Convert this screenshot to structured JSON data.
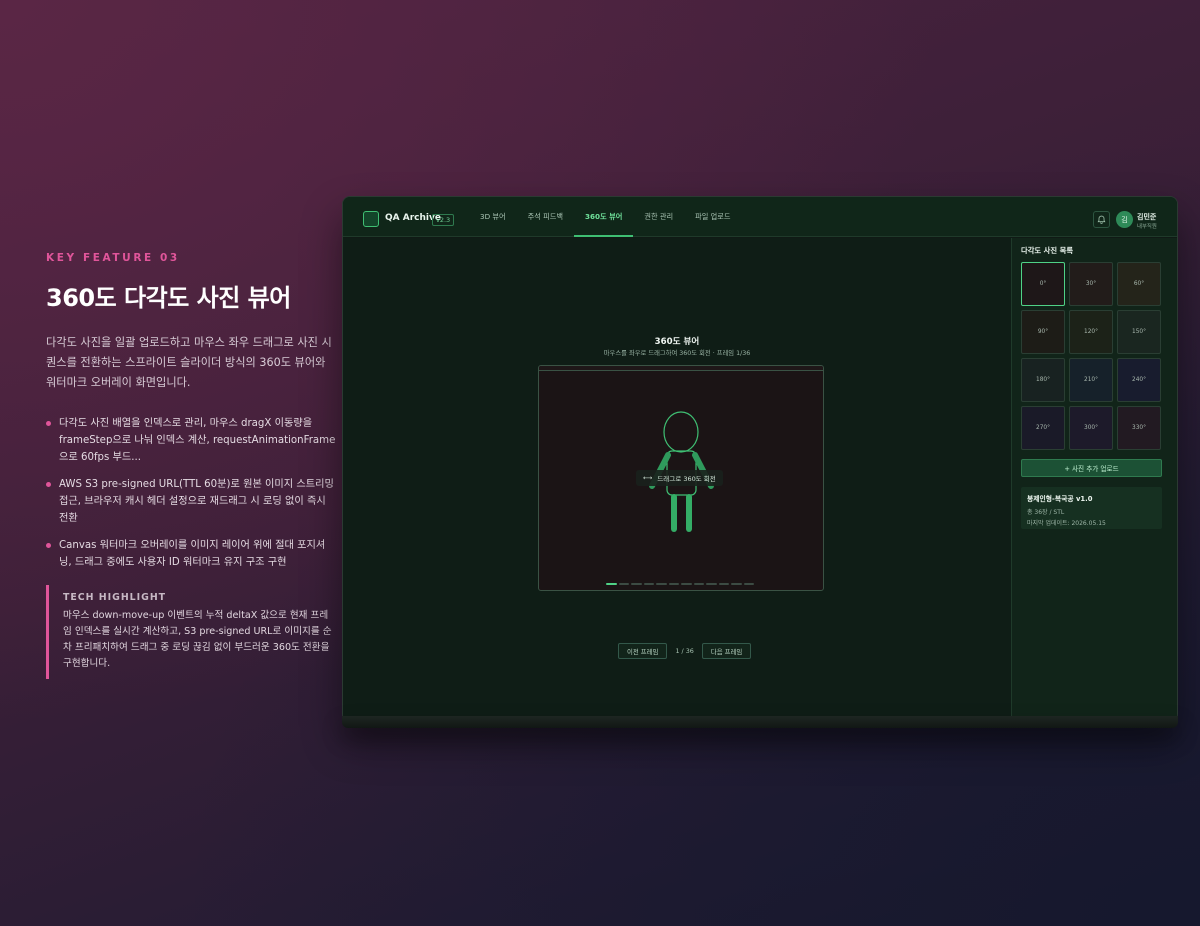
{
  "feature": {
    "kicker": "KEY FEATURE 03",
    "headline": "360도 다각도 사진 뷰어",
    "intro": "다각도 사진을 일괄 업로드하고 마우스 좌우 드래그로 사진 시퀀스를 전환하는 스프라이트 슬라이더 방식의 360도 뷰어와 워터마크 오버레이 화면입니다.",
    "bullets": [
      "다각도 사진 배열을 인덱스로 관리, 마우스 dragX 이동량을 frameStep으로 나눠 인덱스 계산, requestAnimationFrame으로 60fps 부드...",
      "AWS S3 pre-signed URL(TTL 60분)로 원본 이미지 스트리밍 접근, 브라우저 캐시 헤더 설정으로 재드래그 시 로딩 없이 즉시 전환",
      "Canvas 워터마크 오버레이를 이미지 레이어 위에 절대 포지셔닝, 드래그 중에도 사용자 ID 워터마크 유지 구조 구현"
    ],
    "highlight_title": "TECH HIGHLIGHT",
    "highlight_body": "마우스 down-move-up 이벤트의 누적 deltaX 값으로 현재 프레임 인덱스를 실시간 계산하고, S3 pre-signed URL로 이미지를 순차 프리패치하여 드래그 중 로딩 끊김 없이 부드러운 360도 전환을 구현합니다."
  },
  "app": {
    "title": "QA Archive",
    "version": "v2.3",
    "tabs": [
      {
        "label": "3D 뷰어",
        "active": false
      },
      {
        "label": "주석 피드백",
        "active": false
      },
      {
        "label": "360도 뷰어",
        "active": true
      },
      {
        "label": "권한 관리",
        "active": false
      },
      {
        "label": "파일 업로드",
        "active": false
      }
    ],
    "user": {
      "initial": "김",
      "name": "김민준",
      "role": "내부직원"
    },
    "icons": {
      "bell": "bell-icon",
      "drag": "drag-arrows-icon"
    },
    "accent": "#3fbf73"
  },
  "viewer": {
    "title": "360도 뷰어",
    "subtitle": "마우스를 좌우로 드래그하여 360도 회전 · 프레임 1/36",
    "drag_hint": "드래그로 360도 회전",
    "drag_icon": "⟷",
    "progress_total_segments": 12,
    "progress_active_index": 0,
    "prev_label": "이전 프레임",
    "counter": "1 / 36",
    "next_label": "다음 프레임"
  },
  "sidebar": {
    "title": "다각도 사진 목록",
    "thumbnails": [
      {
        "label": "0°",
        "color": "#1e1718",
        "selected": true
      },
      {
        "label": "30°",
        "color": "#221c1a",
        "selected": false
      },
      {
        "label": "60°",
        "color": "#24241a",
        "selected": false
      },
      {
        "label": "90°",
        "color": "#1d1c17",
        "selected": false
      },
      {
        "label": "120°",
        "color": "#1c2218",
        "selected": false
      },
      {
        "label": "150°",
        "color": "#1a2620",
        "selected": false
      },
      {
        "label": "180°",
        "color": "#182221",
        "selected": false
      },
      {
        "label": "210°",
        "color": "#16212a",
        "selected": false
      },
      {
        "label": "240°",
        "color": "#181c2e",
        "selected": false
      },
      {
        "label": "270°",
        "color": "#1a1a28",
        "selected": false
      },
      {
        "label": "300°",
        "color": "#1d1a2a",
        "selected": false
      },
      {
        "label": "330°",
        "color": "#221a22",
        "selected": false
      }
    ],
    "upload_label": "+ 사진 추가 업로드",
    "info": {
      "title": "봉제인형-복국공 v1.0",
      "count": "총 36장 / STL",
      "updated": "마지막 업데이트: 2026.05.15"
    }
  }
}
